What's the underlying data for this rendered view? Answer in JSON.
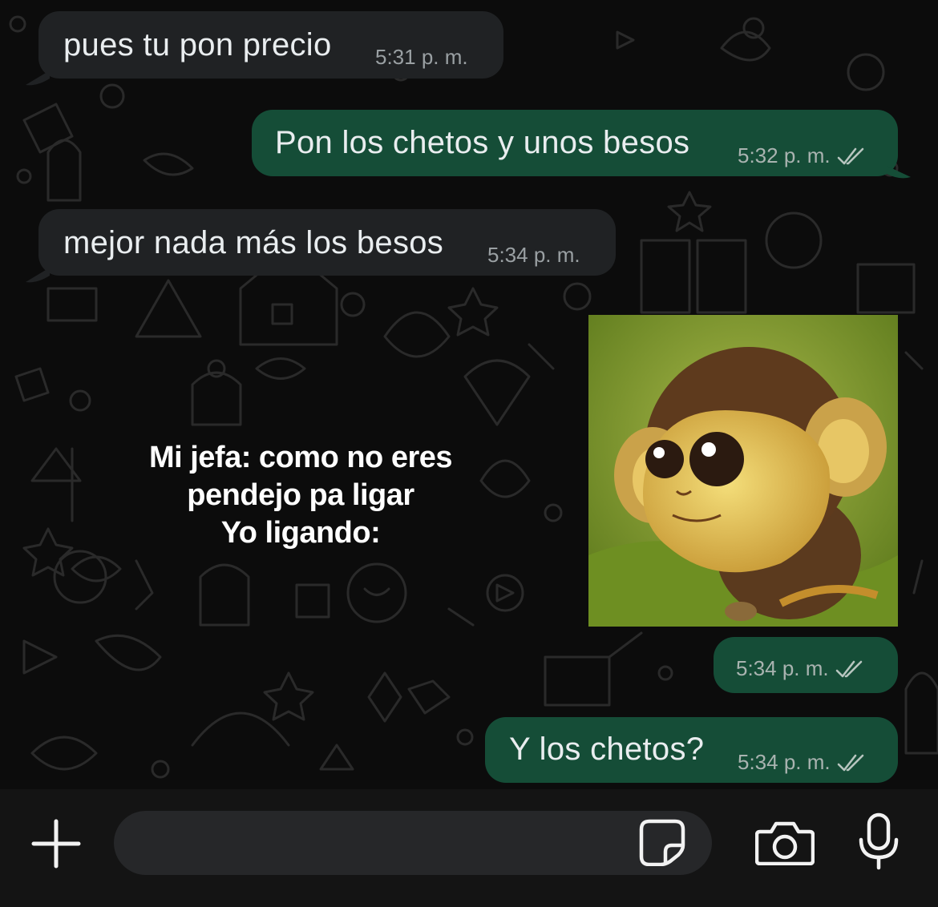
{
  "messages": [
    {
      "direction": "incoming",
      "text": "pues tu pon precio",
      "time": "5:31 p. m."
    },
    {
      "direction": "outgoing",
      "text": "Pon los chetos y unos besos",
      "time": "5:32 p. m.",
      "status": "read"
    },
    {
      "direction": "incoming",
      "text": "mejor nada más los besos",
      "time": "5:34 p. m."
    },
    {
      "direction": "outgoing",
      "type": "image",
      "time": "5:34 p. m.",
      "status": "read"
    },
    {
      "direction": "outgoing",
      "text": "Y los chetos?",
      "time": "5:34 p. m.",
      "status": "read"
    }
  ],
  "caption": {
    "line1": "Mi jefa: como no eres",
    "line2": "pendejo pa ligar",
    "line3": "Yo ligando:"
  },
  "composer": {
    "plus_icon": "plus-icon",
    "sticker_icon": "sticker-icon",
    "camera_icon": "camera-icon",
    "mic_icon": "microphone-icon"
  },
  "colors": {
    "incoming_bubble": "#202224",
    "outgoing_bubble": "#154d37",
    "background": "#0c0c0c"
  }
}
